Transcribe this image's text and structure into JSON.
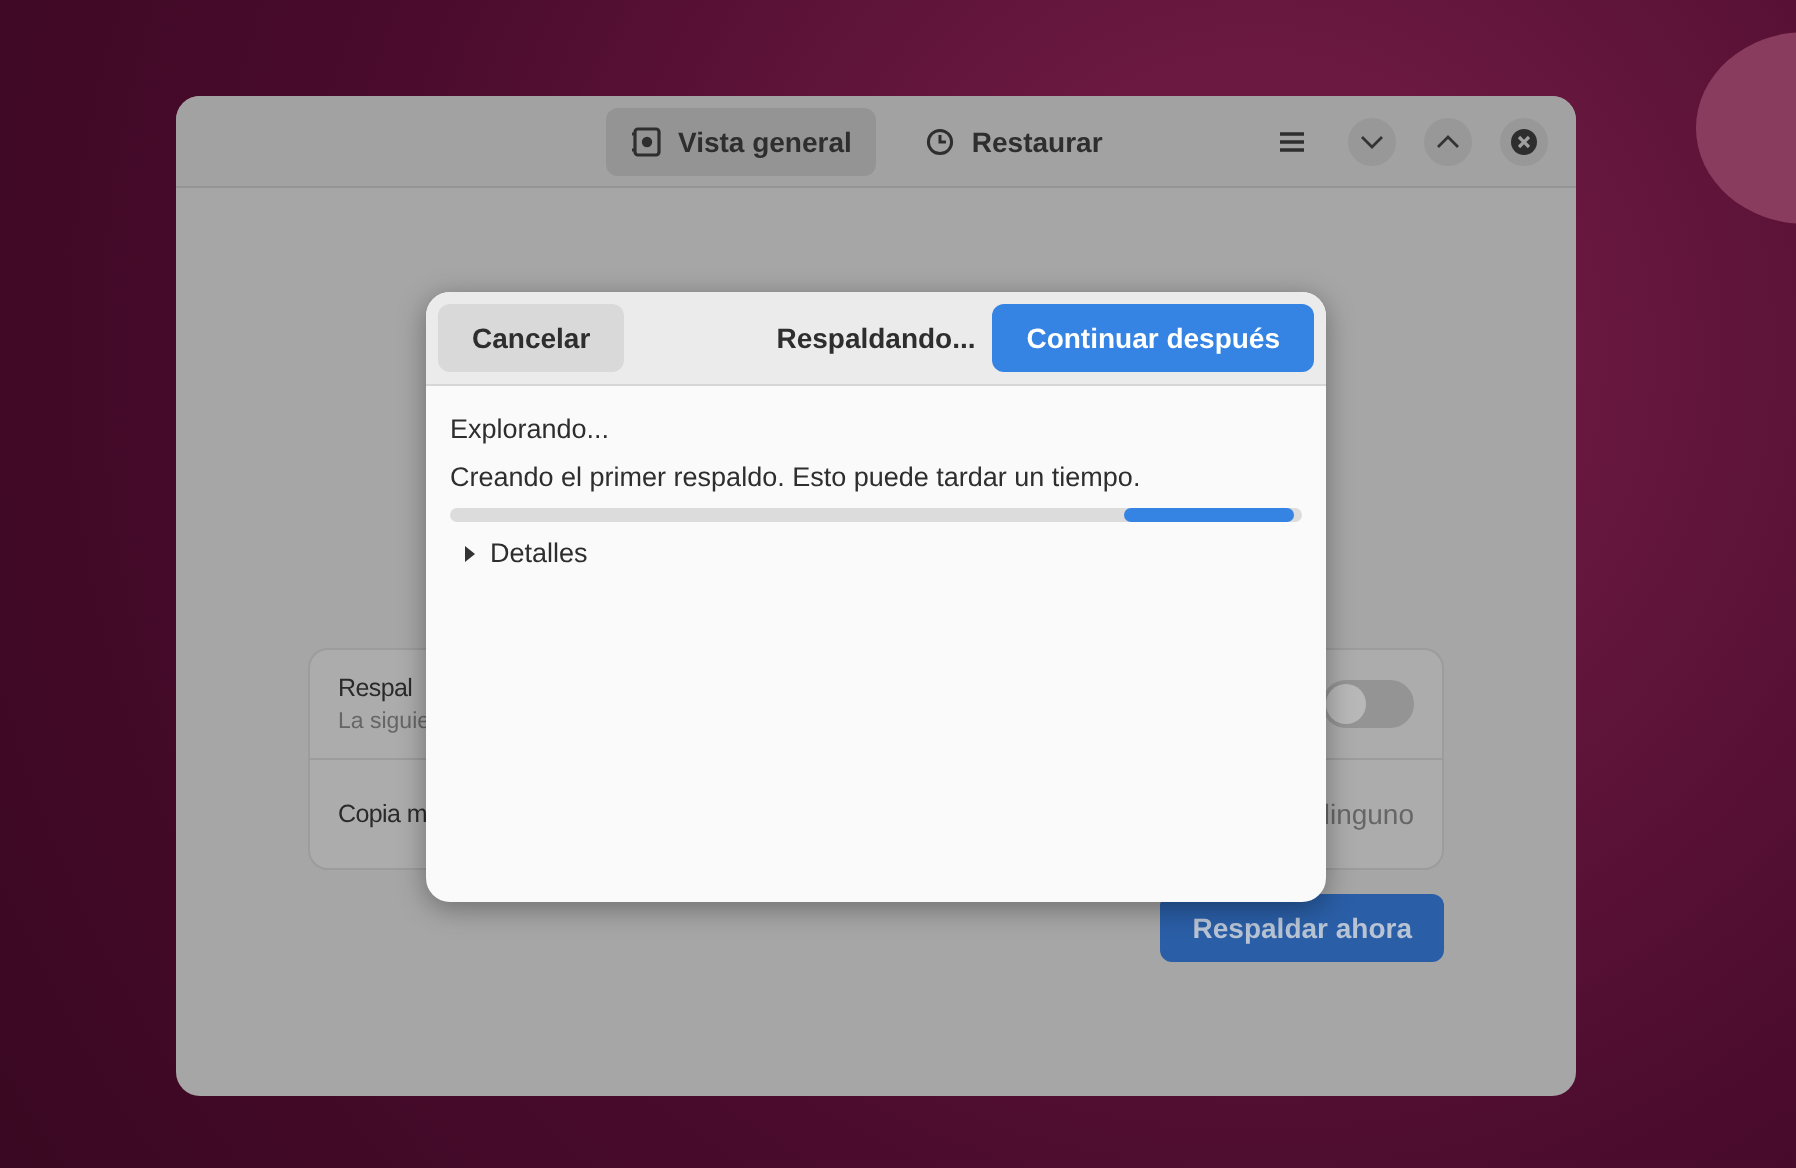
{
  "window": {
    "tabs": [
      {
        "label": "Vista general",
        "selected": true
      },
      {
        "label": "Restaurar",
        "selected": false
      }
    ],
    "settings": [
      {
        "title": "Respal",
        "subtitle": "La siguie",
        "kind": "switch",
        "on": false
      },
      {
        "title": "Copia m",
        "value": "linguno",
        "kind": "value"
      }
    ],
    "primary_button": "Respaldar ahora"
  },
  "dialog": {
    "title": "Respaldando...",
    "cancel_button": "Cancelar",
    "continue_button": "Continuar después",
    "status": "Explorando...",
    "message": "Creando el primer respaldo. Esto puede tardar un tiempo.",
    "details": {
      "label": "Detalles",
      "expanded": false
    }
  }
}
